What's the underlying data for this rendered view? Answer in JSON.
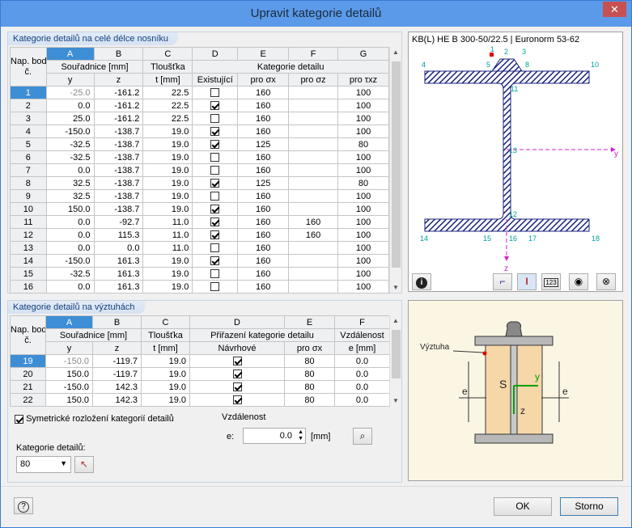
{
  "window": {
    "title": "Upravit kategorie detailů",
    "close_glyph": "✕"
  },
  "top_panel": {
    "title": "Kategorie detailů na celé délce nosníku",
    "col_letters": [
      "A",
      "B",
      "C",
      "D",
      "E",
      "F",
      "G"
    ],
    "hdr1": {
      "rowhead": "Nap. bod",
      "coords": "Souřadnice [mm]",
      "thick": "Tloušťka",
      "cat": "Kategorie detailu"
    },
    "hdr2": {
      "rowhead": "č.",
      "y": "y",
      "z": "z",
      "t": "t [mm]",
      "exist": "Existující",
      "sx": "pro σx",
      "sz": "pro σz",
      "txz": "pro τxz"
    },
    "rows": [
      {
        "n": "1",
        "y": "-25.0",
        "z": "-161.2",
        "t": "22.5",
        "ex": false,
        "sx": "160",
        "sz": "",
        "txz": "100"
      },
      {
        "n": "2",
        "y": "0.0",
        "z": "-161.2",
        "t": "22.5",
        "ex": true,
        "sx": "160",
        "sz": "",
        "txz": "100"
      },
      {
        "n": "3",
        "y": "25.0",
        "z": "-161.2",
        "t": "22.5",
        "ex": false,
        "sx": "160",
        "sz": "",
        "txz": "100"
      },
      {
        "n": "4",
        "y": "-150.0",
        "z": "-138.7",
        "t": "19.0",
        "ex": true,
        "sx": "160",
        "sz": "",
        "txz": "100"
      },
      {
        "n": "5",
        "y": "-32.5",
        "z": "-138.7",
        "t": "19.0",
        "ex": true,
        "sx": "125",
        "sz": "",
        "txz": "80"
      },
      {
        "n": "6",
        "y": "-32.5",
        "z": "-138.7",
        "t": "19.0",
        "ex": false,
        "sx": "160",
        "sz": "",
        "txz": "100"
      },
      {
        "n": "7",
        "y": "0.0",
        "z": "-138.7",
        "t": "19.0",
        "ex": false,
        "sx": "160",
        "sz": "",
        "txz": "100"
      },
      {
        "n": "8",
        "y": "32.5",
        "z": "-138.7",
        "t": "19.0",
        "ex": true,
        "sx": "125",
        "sz": "",
        "txz": "80"
      },
      {
        "n": "9",
        "y": "32.5",
        "z": "-138.7",
        "t": "19.0",
        "ex": false,
        "sx": "160",
        "sz": "",
        "txz": "100"
      },
      {
        "n": "10",
        "y": "150.0",
        "z": "-138.7",
        "t": "19.0",
        "ex": true,
        "sx": "160",
        "sz": "",
        "txz": "100"
      },
      {
        "n": "11",
        "y": "0.0",
        "z": "-92.7",
        "t": "11.0",
        "ex": true,
        "sx": "160",
        "sz": "160",
        "txz": "100"
      },
      {
        "n": "12",
        "y": "0.0",
        "z": "115.3",
        "t": "11.0",
        "ex": true,
        "sx": "160",
        "sz": "160",
        "txz": "100"
      },
      {
        "n": "13",
        "y": "0.0",
        "z": "0.0",
        "t": "11.0",
        "ex": false,
        "sx": "160",
        "sz": "",
        "txz": "100"
      },
      {
        "n": "14",
        "y": "-150.0",
        "z": "161.3",
        "t": "19.0",
        "ex": true,
        "sx": "160",
        "sz": "",
        "txz": "100"
      },
      {
        "n": "15",
        "y": "-32.5",
        "z": "161.3",
        "t": "19.0",
        "ex": false,
        "sx": "160",
        "sz": "",
        "txz": "100"
      },
      {
        "n": "16",
        "y": "0.0",
        "z": "161.3",
        "t": "19.0",
        "ex": false,
        "sx": "160",
        "sz": "",
        "txz": "100"
      }
    ]
  },
  "bottom_panel": {
    "title": "Kategorie detailů na výztuhách",
    "col_letters": [
      "A",
      "B",
      "C",
      "D",
      "E",
      "F"
    ],
    "hdr1": {
      "rowhead": "Nap. bod",
      "coords": "Souřadnice [mm]",
      "thick": "Tloušťka",
      "assign": "Přiřazení kategorie detailu",
      "dist": "Vzdálenost"
    },
    "hdr2": {
      "rowhead": "č.",
      "y": "y",
      "z": "z",
      "t": "t [mm]",
      "design": "Návrhové",
      "sx": "pro σx",
      "e": "e [mm]"
    },
    "rows": [
      {
        "n": "19",
        "y": "-150.0",
        "z": "-119.7",
        "t": "19.0",
        "d": true,
        "sx": "80",
        "e": "0.0"
      },
      {
        "n": "20",
        "y": "150.0",
        "z": "-119.7",
        "t": "19.0",
        "d": true,
        "sx": "80",
        "e": "0.0"
      },
      {
        "n": "21",
        "y": "-150.0",
        "z": "142.3",
        "t": "19.0",
        "d": true,
        "sx": "80",
        "e": "0.0"
      },
      {
        "n": "22",
        "y": "150.0",
        "z": "142.3",
        "t": "19.0",
        "d": true,
        "sx": "80",
        "e": "0.0"
      }
    ],
    "sym_label": "Symetrické rozložení kategorií detailů",
    "cat_label": "Kategorie detailů:",
    "cat_value": "80",
    "dist_label": "Vzdálenost",
    "e_label": "e:",
    "e_value": "0.0",
    "e_unit": "[mm]"
  },
  "preview": {
    "caption": "KB(L) HE B 300-50/22.5 | Euronorm 53-62",
    "points": {
      "p1": "1",
      "p2": "2",
      "p3": "3",
      "p4": "4",
      "p5": "5",
      "p8": "8",
      "p10": "10",
      "p11": "11",
      "p12": "12",
      "p13": "13",
      "p14": "14",
      "p15": "15",
      "p16": "16",
      "p17": "17",
      "p18": "18"
    },
    "y_axis": "y",
    "z_axis": "z",
    "toolbar_icons": [
      "info-icon",
      "axes-icon",
      "section-icon",
      "numbering-icon",
      "eye-icon",
      "reset-view-icon"
    ]
  },
  "stiffener": {
    "label": "Výztuha",
    "s": "S",
    "y": "y",
    "z": "z",
    "e_left": "e",
    "e_right": "e"
  },
  "footer": {
    "ok": "OK",
    "cancel": "Storno"
  },
  "colors": {
    "accent": "#3e8ed6",
    "hatch": "#1a237e",
    "points": "#00a0a0"
  }
}
